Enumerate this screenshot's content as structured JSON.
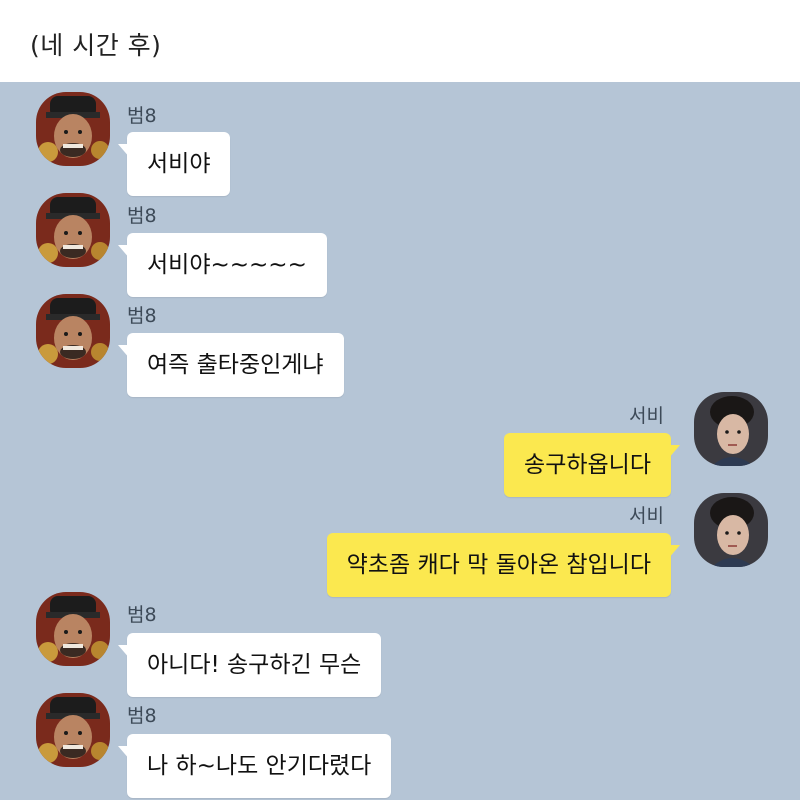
{
  "header": {
    "title": "(네 시간 후)"
  },
  "colors": {
    "chat_bg": "#b5c5d6",
    "incoming_bubble": "#ffffff",
    "outgoing_bubble": "#fbe84f"
  },
  "messages": [
    {
      "sender": "범8",
      "text": "서비야",
      "direction": "incoming",
      "avatar": "king-avatar"
    },
    {
      "sender": "범8",
      "text": "서비야~~~~~",
      "direction": "incoming",
      "avatar": "king-avatar"
    },
    {
      "sender": "범8",
      "text": "여즉 출타중인게냐",
      "direction": "incoming",
      "avatar": "king-avatar"
    },
    {
      "sender": "서비",
      "text": "송구하옵니다",
      "direction": "outgoing",
      "avatar": "woman-avatar"
    },
    {
      "sender": "서비",
      "text": "약초좀 캐다 막 돌아온 참입니다",
      "direction": "outgoing",
      "avatar": "woman-avatar"
    },
    {
      "sender": "범8",
      "text": "아니다! 송구하긴 무슨",
      "direction": "incoming",
      "avatar": "king-avatar"
    },
    {
      "sender": "범8",
      "text": "나 하~나도 안기다렸다",
      "direction": "incoming",
      "avatar": "king-avatar"
    }
  ]
}
